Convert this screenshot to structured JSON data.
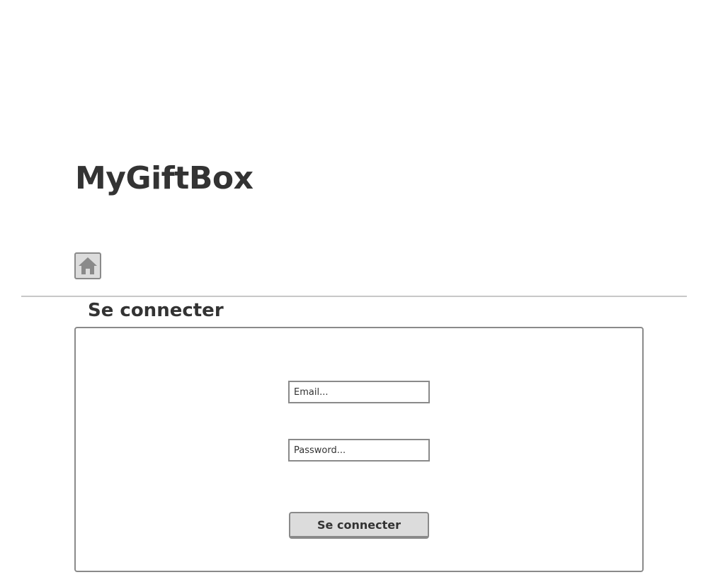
{
  "header": {
    "brand": "MyGiftBox"
  },
  "nav": {
    "home_icon": "home-icon"
  },
  "login": {
    "title": "Se connecter",
    "email_placeholder": "Email...",
    "password_placeholder": "Password...",
    "submit_label": "Se connecter"
  },
  "colors": {
    "text": "#333333",
    "border": "#8a8a8a",
    "button_bg": "#dcdcdc",
    "divider": "#c8c8c8"
  }
}
